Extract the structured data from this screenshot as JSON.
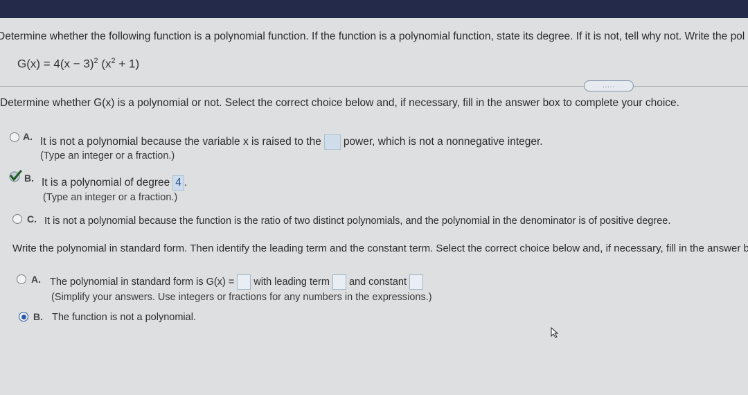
{
  "question": {
    "prompt": "Determine whether the following function is a polynomial function. If the function is a polynomial function, state its degree. If it is not, tell why not. Write the pol",
    "function_parts": {
      "lhs": "G(x) = 4(x − 3)",
      "exp1": "2",
      "mid": " (x",
      "exp2": "2",
      "rhs": " + 1)"
    }
  },
  "expander_label": ".....",
  "part1": {
    "instruction": "Determine whether G(x) is a polynomial or not. Select the correct choice below and, if necessary, fill in the answer box to complete your choice.",
    "choices": [
      {
        "letter": "A.",
        "text_before": "It is not a polynomial because the variable x is raised to the",
        "text_after": "power, which is not a nonnegative integer.",
        "hint": "(Type an integer or a fraction.)"
      },
      {
        "letter": "B.",
        "text_before": "It is a polynomial of degree",
        "answer": "4",
        "text_after": ".",
        "hint": "(Type an integer or a fraction.)"
      },
      {
        "letter": "C.",
        "text": "It is not a polynomial because the function is the ratio of two distinct polynomials, and the polynomial in the denominator is of positive degree."
      }
    ],
    "selected": "B"
  },
  "part2": {
    "instruction": "Write the polynomial in standard form. Then identify the leading term and the constant term. Select the correct choice below and, if necessary, fill in the answer bo",
    "choices": [
      {
        "letter": "A.",
        "text1": "The polynomial in standard form is G(x) =",
        "text2": "with leading term",
        "text3": "and constant",
        "hint": "(Simplify your answers. Use integers or fractions for any numbers in the expressions.)"
      },
      {
        "letter": "B.",
        "text": "The function is not a polynomial."
      }
    ],
    "selected": "B"
  }
}
